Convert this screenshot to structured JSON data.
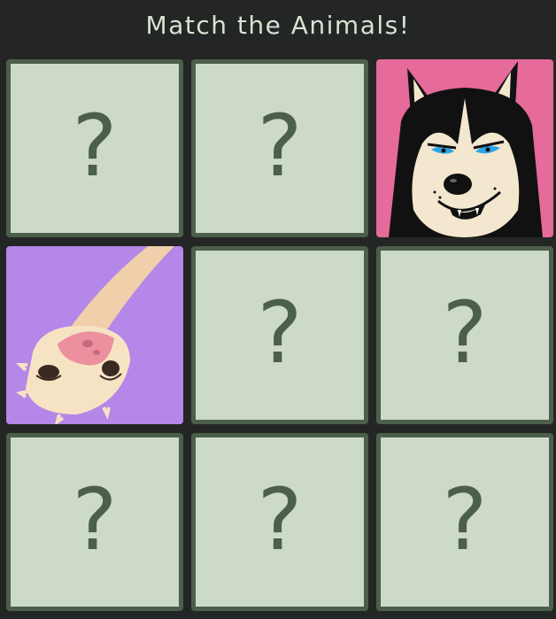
{
  "header": {
    "title": "Match the Animals!"
  },
  "cards": [
    {
      "state": "hidden",
      "symbol": "?"
    },
    {
      "state": "hidden",
      "symbol": "?"
    },
    {
      "state": "revealed",
      "animal": "husky",
      "background": "#e66a9a"
    },
    {
      "state": "revealed",
      "animal": "ostrich",
      "background": "#b487e8"
    },
    {
      "state": "hidden",
      "symbol": "?"
    },
    {
      "state": "hidden",
      "symbol": "?"
    },
    {
      "state": "hidden",
      "symbol": "?"
    },
    {
      "state": "hidden",
      "symbol": "?"
    },
    {
      "state": "hidden",
      "symbol": "?"
    }
  ],
  "colors": {
    "page_bg": "#242625",
    "card_face": "#cdd9c9",
    "card_border": "#4b5f4a",
    "question_mark": "#4c5f49",
    "title_text": "#d7e3d1"
  }
}
